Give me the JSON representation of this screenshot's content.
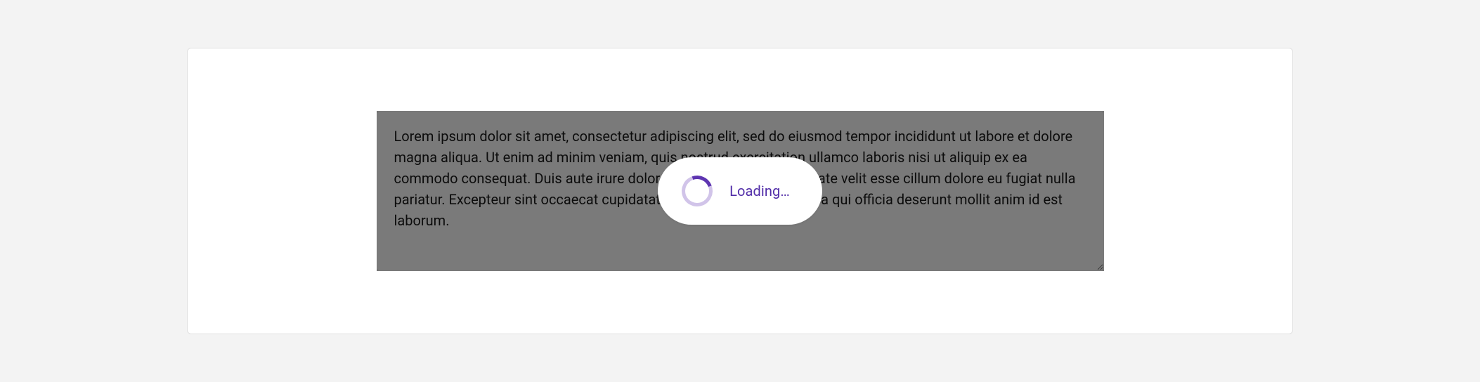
{
  "textarea": {
    "value": "Lorem ipsum dolor sit amet, consectetur adipiscing elit, sed do eiusmod tempor incididunt ut labore et dolore magna aliqua. Ut enim ad minim veniam, quis nostrud exercitation ullamco laboris nisi ut aliquip ex ea commodo consequat. Duis aute irure dolor in reprehenderit in voluptate velit esse cillum dolore eu fugiat nulla pariatur. Excepteur sint occaecat cupidatat non proident, sunt in culpa qui officia deserunt mollit anim id est laborum."
  },
  "loading": {
    "label": "Loading…"
  },
  "colors": {
    "accent": "#5e35b1",
    "accentLight": "#d1c4e9",
    "overlay": "rgba(0,0,0,0.52)"
  }
}
